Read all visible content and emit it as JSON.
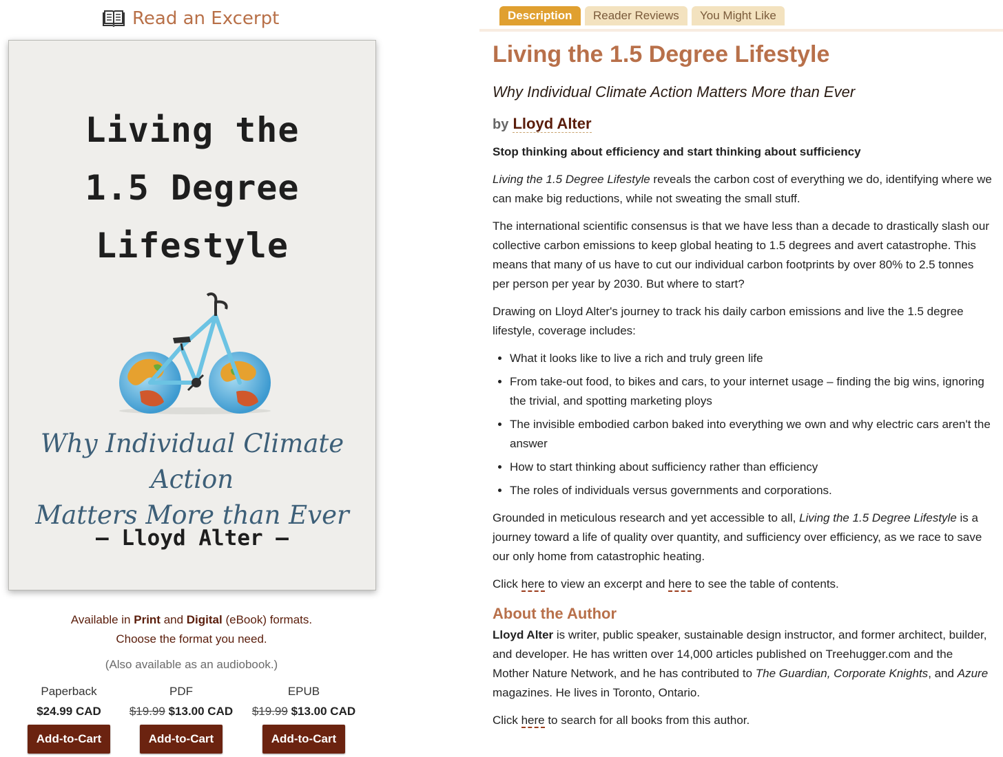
{
  "excerpt": {
    "label": "Read an Excerpt",
    "icon": "open-book-icon"
  },
  "cover": {
    "title_lines": [
      "Living the",
      "1.5 Degree",
      "Lifestyle"
    ],
    "subtitle_lines": [
      "Why Individual Climate Action",
      "Matters More than Ever"
    ],
    "author": "— Lloyd Alter —"
  },
  "formats": {
    "line1_pre": "Available in ",
    "print": "Print",
    "and": " and ",
    "digital": "Digital",
    "line1_post": " (eBook) formats.",
    "line2": "Choose the format you need.",
    "audio": "(Also available as an audiobook.)",
    "items": [
      {
        "name": "Paperback",
        "old_price": "",
        "price": "$24.99 CAD",
        "button": "Add-to-Cart"
      },
      {
        "name": "PDF",
        "old_price": "$19.99",
        "price": "$13.00 CAD",
        "button": "Add-to-Cart"
      },
      {
        "name": "EPUB",
        "old_price": "$19.99",
        "price": "$13.00 CAD",
        "button": "Add-to-Cart"
      }
    ]
  },
  "tabs": [
    "Description",
    "Reader Reviews",
    "You Might Like"
  ],
  "book": {
    "title": "Living the 1.5 Degree Lifestyle",
    "subtitle": "Why Individual Climate Action Matters More than Ever",
    "by": "by",
    "author": "Lloyd Alter",
    "tagline": "Stop thinking about efficiency and start thinking about sufficiency",
    "p1_title": "Living the 1.5 Degree Lifestyle",
    "p1_rest": " reveals the carbon cost of everything we do, identifying where we can make big reductions, while not sweating the small stuff.",
    "p2": "The international scientific consensus is that we have less than a decade to drastically slash our collective carbon emissions to keep global heating to 1.5 degrees and avert catastrophe. This means that many of us have to cut our individual carbon footprints by over 80% to 2.5 tonnes per person per year by 2030. But where to start?",
    "p3": "Drawing on Lloyd Alter's journey to track his daily carbon emissions and live the 1.5 degree lifestyle, coverage includes:",
    "bullets": [
      "What it looks like to live a rich and truly green life",
      "From take-out food, to bikes and cars, to your internet usage – finding the big wins, ignoring the trivial, and spotting marketing ploys",
      "The invisible embodied carbon baked into everything we own and why electric cars aren't the answer",
      "How to start thinking about sufficiency rather than efficiency",
      "The roles of individuals versus governments and corporations."
    ],
    "p4_pre": "Grounded in meticulous research and yet accessible to all, ",
    "p4_title": "Living the 1.5 Degree Lifestyle",
    "p4_post": " is a journey toward a life of quality over quantity, and sufficiency over efficiency, as we race to save our only home from catastrophic heating.",
    "click1": "Click ",
    "here": "here",
    "click1_mid": " to view an excerpt and ",
    "click1_end": " to see the table of contents."
  },
  "about": {
    "heading": "About the Author",
    "name": "Lloyd Alter",
    "text1": " is writer, public speaker, sustainable design instructor, and former architect, builder, and developer. He has written over 14,000 articles published on Treehugger.com and the Mother Nature Network, and he has contributed to ",
    "pubs": "The Guardian, Corporate Knights",
    "text2": ", and ",
    "azure": "Azure",
    "text3": " magazines. He lives in Toronto, Ontario.",
    "click_pre": "Click ",
    "here": "here",
    "click_post": " to search for all books from this author."
  }
}
